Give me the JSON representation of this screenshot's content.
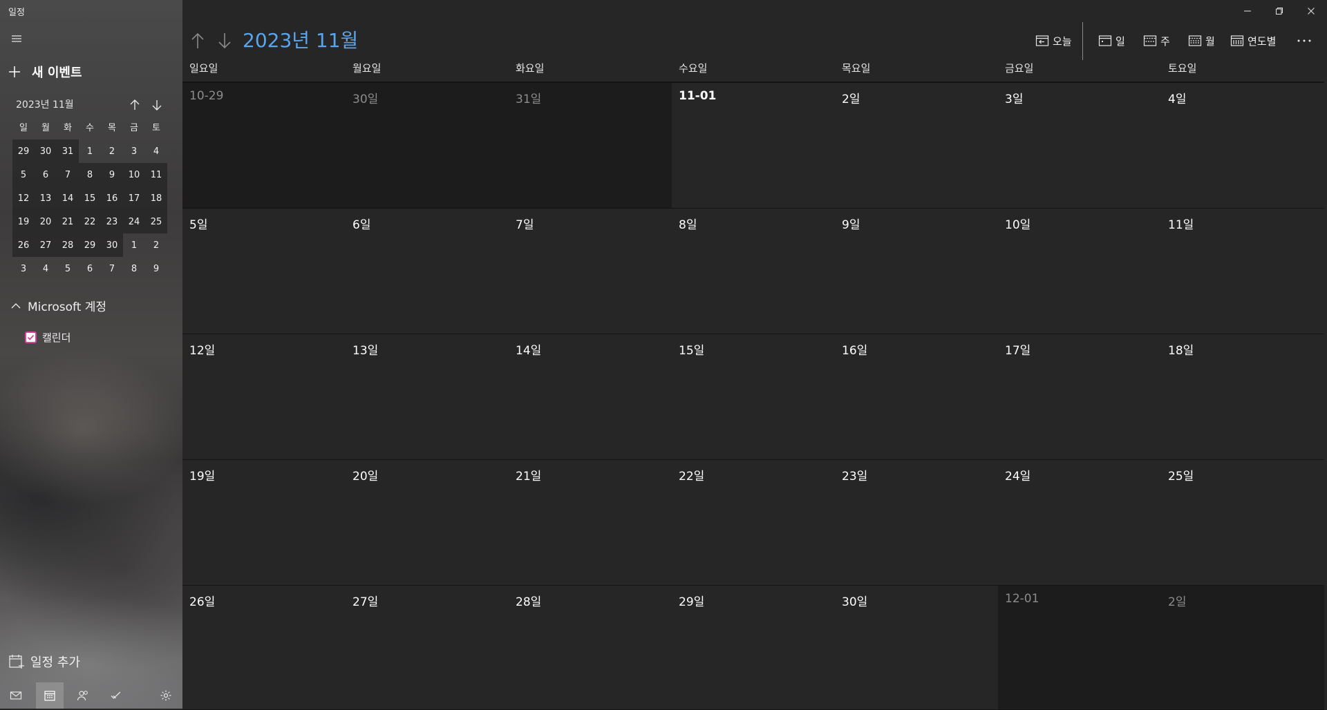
{
  "app": {
    "title": "일정"
  },
  "sidebar": {
    "new_event_label": "새 이벤트",
    "mini_calendar": {
      "month_label": "2023년 11월",
      "days_of_week": [
        "일",
        "월",
        "화",
        "수",
        "목",
        "금",
        "토"
      ],
      "weeks": [
        [
          "29",
          "30",
          "31",
          "1",
          "2",
          "3",
          "4"
        ],
        [
          "5",
          "6",
          "7",
          "8",
          "9",
          "10",
          "11"
        ],
        [
          "12",
          "13",
          "14",
          "15",
          "16",
          "17",
          "18"
        ],
        [
          "19",
          "20",
          "21",
          "22",
          "23",
          "24",
          "25"
        ],
        [
          "26",
          "27",
          "28",
          "29",
          "30",
          "1",
          "2"
        ],
        [
          "3",
          "4",
          "5",
          "6",
          "7",
          "8",
          "9"
        ]
      ]
    },
    "account_label": "Microsoft 계정",
    "calendar_label": "캘린더",
    "add_calendar_label": "일정 추가",
    "bottom_nav": [
      "mail",
      "calendar",
      "people",
      "todo",
      "settings"
    ]
  },
  "header": {
    "month_title": "2023년 11월",
    "toolbar": {
      "today": "오늘",
      "day": "일",
      "week": "주",
      "month": "월",
      "year": "연도별"
    }
  },
  "calendar": {
    "days_of_week": [
      "일요일",
      "월요일",
      "화요일",
      "수요일",
      "목요일",
      "금요일",
      "토요일"
    ],
    "weeks": [
      [
        "10-29",
        "30일",
        "31일",
        "11-01",
        "2일",
        "3일",
        "4일"
      ],
      [
        "5일",
        "6일",
        "7일",
        "8일",
        "9일",
        "10일",
        "11일"
      ],
      [
        "12일",
        "13일",
        "14일",
        "15일",
        "16일",
        "17일",
        "18일"
      ],
      [
        "19일",
        "20일",
        "21일",
        "22일",
        "23일",
        "24일",
        "25일"
      ],
      [
        "26일",
        "27일",
        "28일",
        "29일",
        "30일",
        "12-01",
        "2일"
      ]
    ],
    "outside_month": [
      [
        0,
        0
      ],
      [
        0,
        1
      ],
      [
        0,
        2
      ],
      [
        4,
        5
      ],
      [
        4,
        6
      ]
    ],
    "bold_date": [
      0,
      3
    ]
  },
  "colors": {
    "accent": "#5aa6ee",
    "background": "#262626",
    "outside_month_bg": "#1c1c1c",
    "checkbox": "#d9439a"
  }
}
